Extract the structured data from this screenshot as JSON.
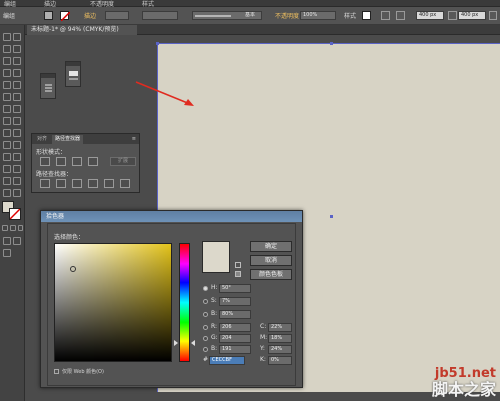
{
  "menubar": {
    "items": [
      "编组",
      "描边",
      "不透明度",
      "样式"
    ]
  },
  "controlbar": {
    "group_label": "编组",
    "stroke_label": "描边",
    "brush_value": "基本",
    "opacity_label": "不透明度",
    "opacity_value": "100%",
    "style_label": "样式",
    "width_value": "400 px",
    "height_value": "400 px",
    "stroke_color": "#d94a1d",
    "fill_color": "#b0b0b0"
  },
  "document": {
    "tab_title": "未标题-1* @ 94% (CMYK/预览)",
    "artboard_color": "#d7d3c5",
    "selection_color": "#5a63c6"
  },
  "pathfinder": {
    "tab_transparency": "对齐",
    "tab_pathfinder": "路径查找器",
    "shape_modes_label": "形状模式：",
    "expand_label": "扩展",
    "pathfinders_label": "路径查找器："
  },
  "color_picker": {
    "title": "拾色器",
    "select_color_label": "选择颜色：",
    "ok_label": "确定",
    "cancel_label": "取消",
    "swatches_label": "颜色色板",
    "hsb": [
      {
        "label": "H:",
        "value": "50°"
      },
      {
        "label": "S:",
        "value": "7%"
      },
      {
        "label": "B:",
        "value": "80%"
      }
    ],
    "rgb": [
      {
        "label": "R:",
        "value": "206"
      },
      {
        "label": "G:",
        "value": "204"
      },
      {
        "label": "B:",
        "value": "191"
      }
    ],
    "cmyk": [
      {
        "label": "C:",
        "value": "22%"
      },
      {
        "label": "M:",
        "value": "18%"
      },
      {
        "label": "Y:",
        "value": "24%"
      },
      {
        "label": "K:",
        "value": "0%"
      }
    ],
    "hex_label": "#",
    "hex_value": "CECCBF",
    "websafe_label": "仅限 Web 颜色(O)",
    "current_color": "#dcd8cb",
    "hue_color": "#e3c31a"
  },
  "watermark": {
    "site": "jb51.net",
    "brand": "脚本之家"
  },
  "annotation": {
    "arrow_color": "#e02b20"
  }
}
